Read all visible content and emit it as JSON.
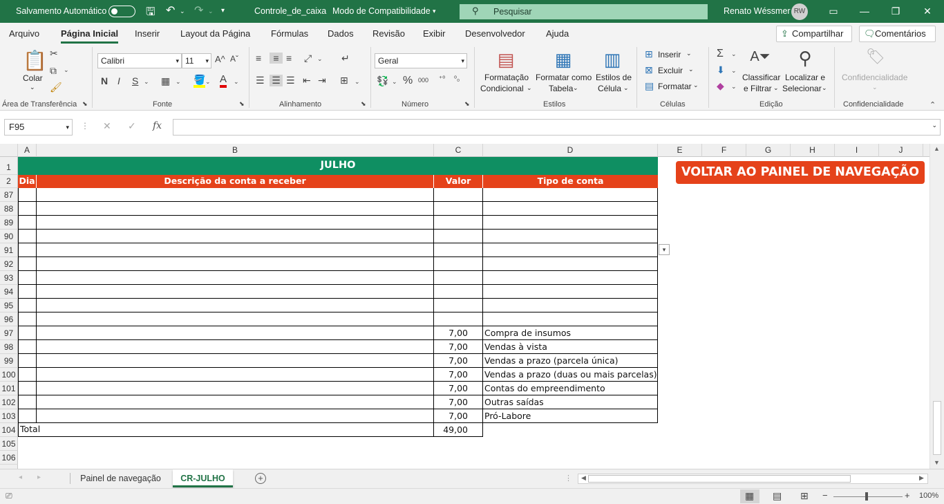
{
  "titlebar": {
    "autosave_label": "Salvamento Automático",
    "filename": "Controle_de_caixa",
    "mode": "Modo de Compatibilidade",
    "search_placeholder": "Pesquisar",
    "user_name": "Renato Wéssmer",
    "user_initials": "RW"
  },
  "menu": {
    "items": [
      "Arquivo",
      "Página Inicial",
      "Inserir",
      "Layout da Página",
      "Fórmulas",
      "Dados",
      "Revisão",
      "Exibir",
      "Desenvolvedor",
      "Ajuda"
    ],
    "share": "Compartilhar",
    "comments": "Comentários"
  },
  "ribbon": {
    "clipboard": {
      "paste": "Colar",
      "label": "Área de Transferência"
    },
    "font": {
      "name": "Calibri",
      "size": "11",
      "bold": "N",
      "italic": "I",
      "underline": "S",
      "label": "Fonte"
    },
    "alignment": {
      "label": "Alinhamento"
    },
    "number": {
      "format": "Geral",
      "label": "Número"
    },
    "styles": {
      "cond_format_1": "Formatação",
      "cond_format_2": "Condicional",
      "format_table_1": "Formatar como",
      "format_table_2": "Tabela",
      "cell_styles_1": "Estilos de",
      "cell_styles_2": "Célula",
      "label": "Estilos"
    },
    "cells": {
      "insert": "Inserir",
      "delete": "Excluir",
      "format": "Formatar",
      "label": "Células"
    },
    "editing": {
      "sort_1": "Classificar",
      "sort_2": "e Filtrar",
      "find_1": "Localizar e",
      "find_2": "Selecionar",
      "label": "Edição"
    },
    "sensitivity": {
      "btn": "Confidencialidade",
      "label": "Confidencialidade"
    }
  },
  "formula_bar": {
    "name_box": "F95",
    "formula": ""
  },
  "columns": [
    "A",
    "B",
    "C",
    "D",
    "E",
    "F",
    "G",
    "H",
    "I",
    "J"
  ],
  "sheet": {
    "title": "JULHO",
    "headers": [
      "Dia",
      "Descrição da conta a receber",
      "Valor (R$)",
      "Tipo de conta"
    ],
    "nav_button": "VOLTAR AO PAINEL DE NAVEGAÇÃO",
    "rows": [
      {
        "n": "87",
        "valor": "",
        "tipo": ""
      },
      {
        "n": "88",
        "valor": "",
        "tipo": ""
      },
      {
        "n": "89",
        "valor": "",
        "tipo": ""
      },
      {
        "n": "90",
        "valor": "",
        "tipo": ""
      },
      {
        "n": "91",
        "valor": "",
        "tipo": ""
      },
      {
        "n": "92",
        "valor": "",
        "tipo": ""
      },
      {
        "n": "93",
        "valor": "",
        "tipo": ""
      },
      {
        "n": "94",
        "valor": "",
        "tipo": ""
      },
      {
        "n": "95",
        "valor": "",
        "tipo": ""
      },
      {
        "n": "96",
        "valor": "",
        "tipo": ""
      },
      {
        "n": "97",
        "valor": "7,00",
        "tipo": "Compra de insumos"
      },
      {
        "n": "98",
        "valor": "7,00",
        "tipo": "Vendas à vista"
      },
      {
        "n": "99",
        "valor": "7,00",
        "tipo": "Vendas a prazo (parcela única)"
      },
      {
        "n": "100",
        "valor": "7,00",
        "tipo": "Vendas a prazo (duas ou mais parcelas)"
      },
      {
        "n": "101",
        "valor": "7,00",
        "tipo": "Contas do empreendimento"
      },
      {
        "n": "102",
        "valor": "7,00",
        "tipo": "Outras saídas"
      },
      {
        "n": "103",
        "valor": "7,00",
        "tipo": "Pró-Labore"
      }
    ],
    "total_row": {
      "n": "104",
      "label": "Total",
      "valor": "49,00"
    },
    "empty_rows": [
      "105",
      "106"
    ]
  },
  "tabs": {
    "items": [
      "Painel de navegação",
      "CR-JULHO"
    ],
    "active": "CR-JULHO"
  },
  "status": {
    "zoom": "100%"
  },
  "colors": {
    "excel_green": "#217346",
    "title_green": "#0f8f62",
    "header_orange": "#e5421a"
  }
}
